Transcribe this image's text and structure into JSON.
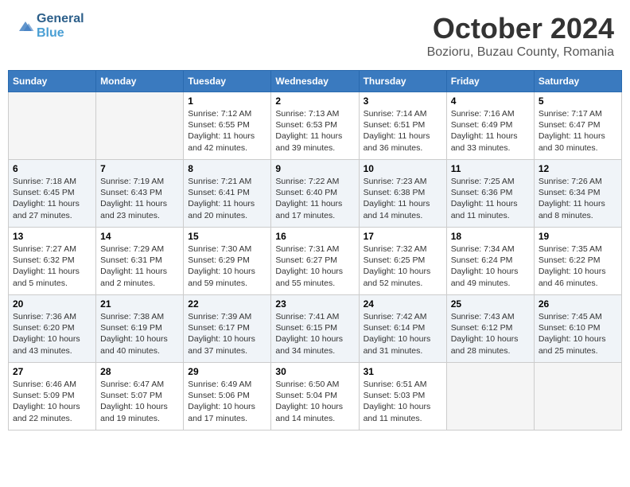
{
  "header": {
    "logo_line1": "General",
    "logo_line2": "Blue",
    "month_title": "October 2024",
    "location": "Bozioru, Buzau County, Romania"
  },
  "weekdays": [
    "Sunday",
    "Monday",
    "Tuesday",
    "Wednesday",
    "Thursday",
    "Friday",
    "Saturday"
  ],
  "weeks": [
    [
      {
        "day": "",
        "content": ""
      },
      {
        "day": "",
        "content": ""
      },
      {
        "day": "1",
        "content": "Sunrise: 7:12 AM\nSunset: 6:55 PM\nDaylight: 11 hours and 42 minutes."
      },
      {
        "day": "2",
        "content": "Sunrise: 7:13 AM\nSunset: 6:53 PM\nDaylight: 11 hours and 39 minutes."
      },
      {
        "day": "3",
        "content": "Sunrise: 7:14 AM\nSunset: 6:51 PM\nDaylight: 11 hours and 36 minutes."
      },
      {
        "day": "4",
        "content": "Sunrise: 7:16 AM\nSunset: 6:49 PM\nDaylight: 11 hours and 33 minutes."
      },
      {
        "day": "5",
        "content": "Sunrise: 7:17 AM\nSunset: 6:47 PM\nDaylight: 11 hours and 30 minutes."
      }
    ],
    [
      {
        "day": "6",
        "content": "Sunrise: 7:18 AM\nSunset: 6:45 PM\nDaylight: 11 hours and 27 minutes."
      },
      {
        "day": "7",
        "content": "Sunrise: 7:19 AM\nSunset: 6:43 PM\nDaylight: 11 hours and 23 minutes."
      },
      {
        "day": "8",
        "content": "Sunrise: 7:21 AM\nSunset: 6:41 PM\nDaylight: 11 hours and 20 minutes."
      },
      {
        "day": "9",
        "content": "Sunrise: 7:22 AM\nSunset: 6:40 PM\nDaylight: 11 hours and 17 minutes."
      },
      {
        "day": "10",
        "content": "Sunrise: 7:23 AM\nSunset: 6:38 PM\nDaylight: 11 hours and 14 minutes."
      },
      {
        "day": "11",
        "content": "Sunrise: 7:25 AM\nSunset: 6:36 PM\nDaylight: 11 hours and 11 minutes."
      },
      {
        "day": "12",
        "content": "Sunrise: 7:26 AM\nSunset: 6:34 PM\nDaylight: 11 hours and 8 minutes."
      }
    ],
    [
      {
        "day": "13",
        "content": "Sunrise: 7:27 AM\nSunset: 6:32 PM\nDaylight: 11 hours and 5 minutes."
      },
      {
        "day": "14",
        "content": "Sunrise: 7:29 AM\nSunset: 6:31 PM\nDaylight: 11 hours and 2 minutes."
      },
      {
        "day": "15",
        "content": "Sunrise: 7:30 AM\nSunset: 6:29 PM\nDaylight: 10 hours and 59 minutes."
      },
      {
        "day": "16",
        "content": "Sunrise: 7:31 AM\nSunset: 6:27 PM\nDaylight: 10 hours and 55 minutes."
      },
      {
        "day": "17",
        "content": "Sunrise: 7:32 AM\nSunset: 6:25 PM\nDaylight: 10 hours and 52 minutes."
      },
      {
        "day": "18",
        "content": "Sunrise: 7:34 AM\nSunset: 6:24 PM\nDaylight: 10 hours and 49 minutes."
      },
      {
        "day": "19",
        "content": "Sunrise: 7:35 AM\nSunset: 6:22 PM\nDaylight: 10 hours and 46 minutes."
      }
    ],
    [
      {
        "day": "20",
        "content": "Sunrise: 7:36 AM\nSunset: 6:20 PM\nDaylight: 10 hours and 43 minutes."
      },
      {
        "day": "21",
        "content": "Sunrise: 7:38 AM\nSunset: 6:19 PM\nDaylight: 10 hours and 40 minutes."
      },
      {
        "day": "22",
        "content": "Sunrise: 7:39 AM\nSunset: 6:17 PM\nDaylight: 10 hours and 37 minutes."
      },
      {
        "day": "23",
        "content": "Sunrise: 7:41 AM\nSunset: 6:15 PM\nDaylight: 10 hours and 34 minutes."
      },
      {
        "day": "24",
        "content": "Sunrise: 7:42 AM\nSunset: 6:14 PM\nDaylight: 10 hours and 31 minutes."
      },
      {
        "day": "25",
        "content": "Sunrise: 7:43 AM\nSunset: 6:12 PM\nDaylight: 10 hours and 28 minutes."
      },
      {
        "day": "26",
        "content": "Sunrise: 7:45 AM\nSunset: 6:10 PM\nDaylight: 10 hours and 25 minutes."
      }
    ],
    [
      {
        "day": "27",
        "content": "Sunrise: 6:46 AM\nSunset: 5:09 PM\nDaylight: 10 hours and 22 minutes."
      },
      {
        "day": "28",
        "content": "Sunrise: 6:47 AM\nSunset: 5:07 PM\nDaylight: 10 hours and 19 minutes."
      },
      {
        "day": "29",
        "content": "Sunrise: 6:49 AM\nSunset: 5:06 PM\nDaylight: 10 hours and 17 minutes."
      },
      {
        "day": "30",
        "content": "Sunrise: 6:50 AM\nSunset: 5:04 PM\nDaylight: 10 hours and 14 minutes."
      },
      {
        "day": "31",
        "content": "Sunrise: 6:51 AM\nSunset: 5:03 PM\nDaylight: 10 hours and 11 minutes."
      },
      {
        "day": "",
        "content": ""
      },
      {
        "day": "",
        "content": ""
      }
    ]
  ]
}
